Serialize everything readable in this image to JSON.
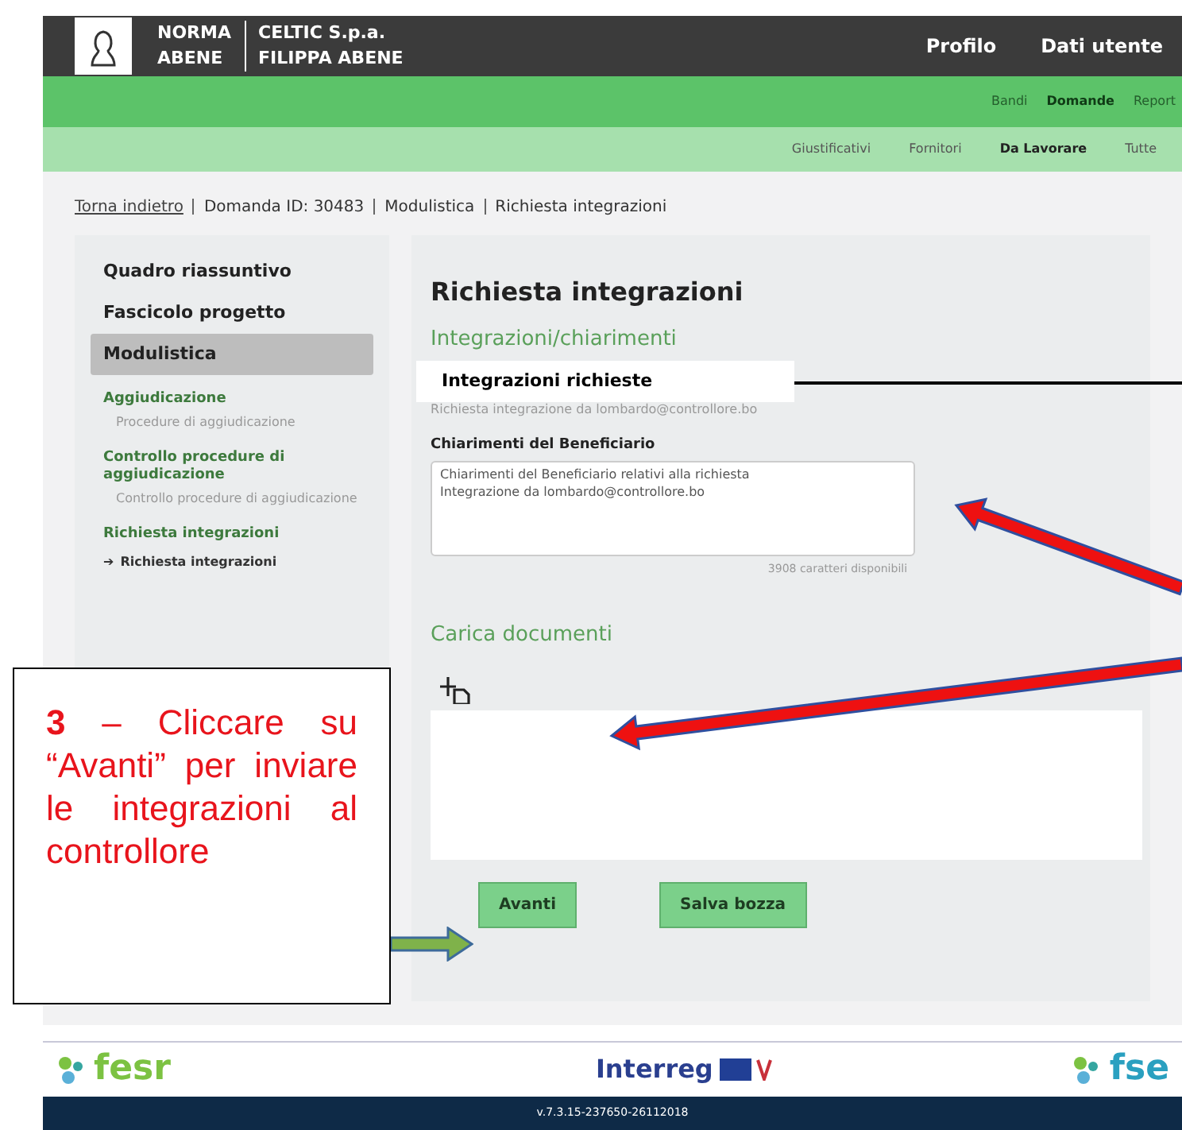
{
  "header": {
    "user_first": "NORMA",
    "user_last": "ABENE",
    "company": "CELTIC S.p.a.",
    "person": "FILIPPA ABENE",
    "links": [
      "Profilo",
      "Dati utente"
    ]
  },
  "nav": [
    {
      "label": "Bandi",
      "selected": false
    },
    {
      "label": "Domande",
      "selected": true
    },
    {
      "label": "Report",
      "selected": false
    }
  ],
  "subnav": [
    {
      "label": "Giustificativi",
      "selected": false
    },
    {
      "label": "Fornitori",
      "selected": false
    },
    {
      "label": "Da Lavorare",
      "selected": true
    },
    {
      "label": "Tutte",
      "selected": false
    }
  ],
  "breadcrumb": {
    "back": "Torna indietro",
    "items": [
      "Domanda ID: 30483",
      "Modulistica",
      "Richiesta integrazioni"
    ]
  },
  "sidebar": [
    {
      "kind": "main",
      "label": "Quadro riassuntivo",
      "selected": false
    },
    {
      "kind": "main",
      "label": "Fascicolo progetto",
      "selected": false
    },
    {
      "kind": "main",
      "label": "Modulistica",
      "selected": true
    },
    {
      "kind": "section",
      "label": "Aggiudicazione"
    },
    {
      "kind": "sub",
      "label": "Procedure di aggiudicazione"
    },
    {
      "kind": "section",
      "label": "Controllo procedure di aggiudicazione"
    },
    {
      "kind": "sub",
      "label": "Controllo procedure di aggiudicazione"
    },
    {
      "kind": "section",
      "label": "Richiesta integrazioni"
    },
    {
      "kind": "current",
      "icon": "➔",
      "label": "Richiesta integrazioni"
    }
  ],
  "main": {
    "title": "Richiesta integrazioni",
    "subtitle": "Integrazioni/chiarimenti",
    "request": "Richiesta integrazione da lombardo@controllore.bo",
    "field_label": "Chiarimenti del Beneficiario",
    "field_value": "Chiarimenti del Beneficiario relativi alla richiesta\nIntegrazione da lombardo@controllore.bo",
    "counter": "3908 caratteri disponibili",
    "upload_title": "Carica documenti",
    "buttons": [
      "Avanti",
      "Salva bozza"
    ]
  },
  "annotations": {
    "label": "Integrazioni richieste",
    "callout": "**3** – Cliccare su “Avanti” per inviare le integrazioni al controllore"
  },
  "footer": {
    "left": "fesr",
    "center": "Interreg",
    "right": "fse",
    "version": "v.7.3.15-237650-26112018"
  }
}
